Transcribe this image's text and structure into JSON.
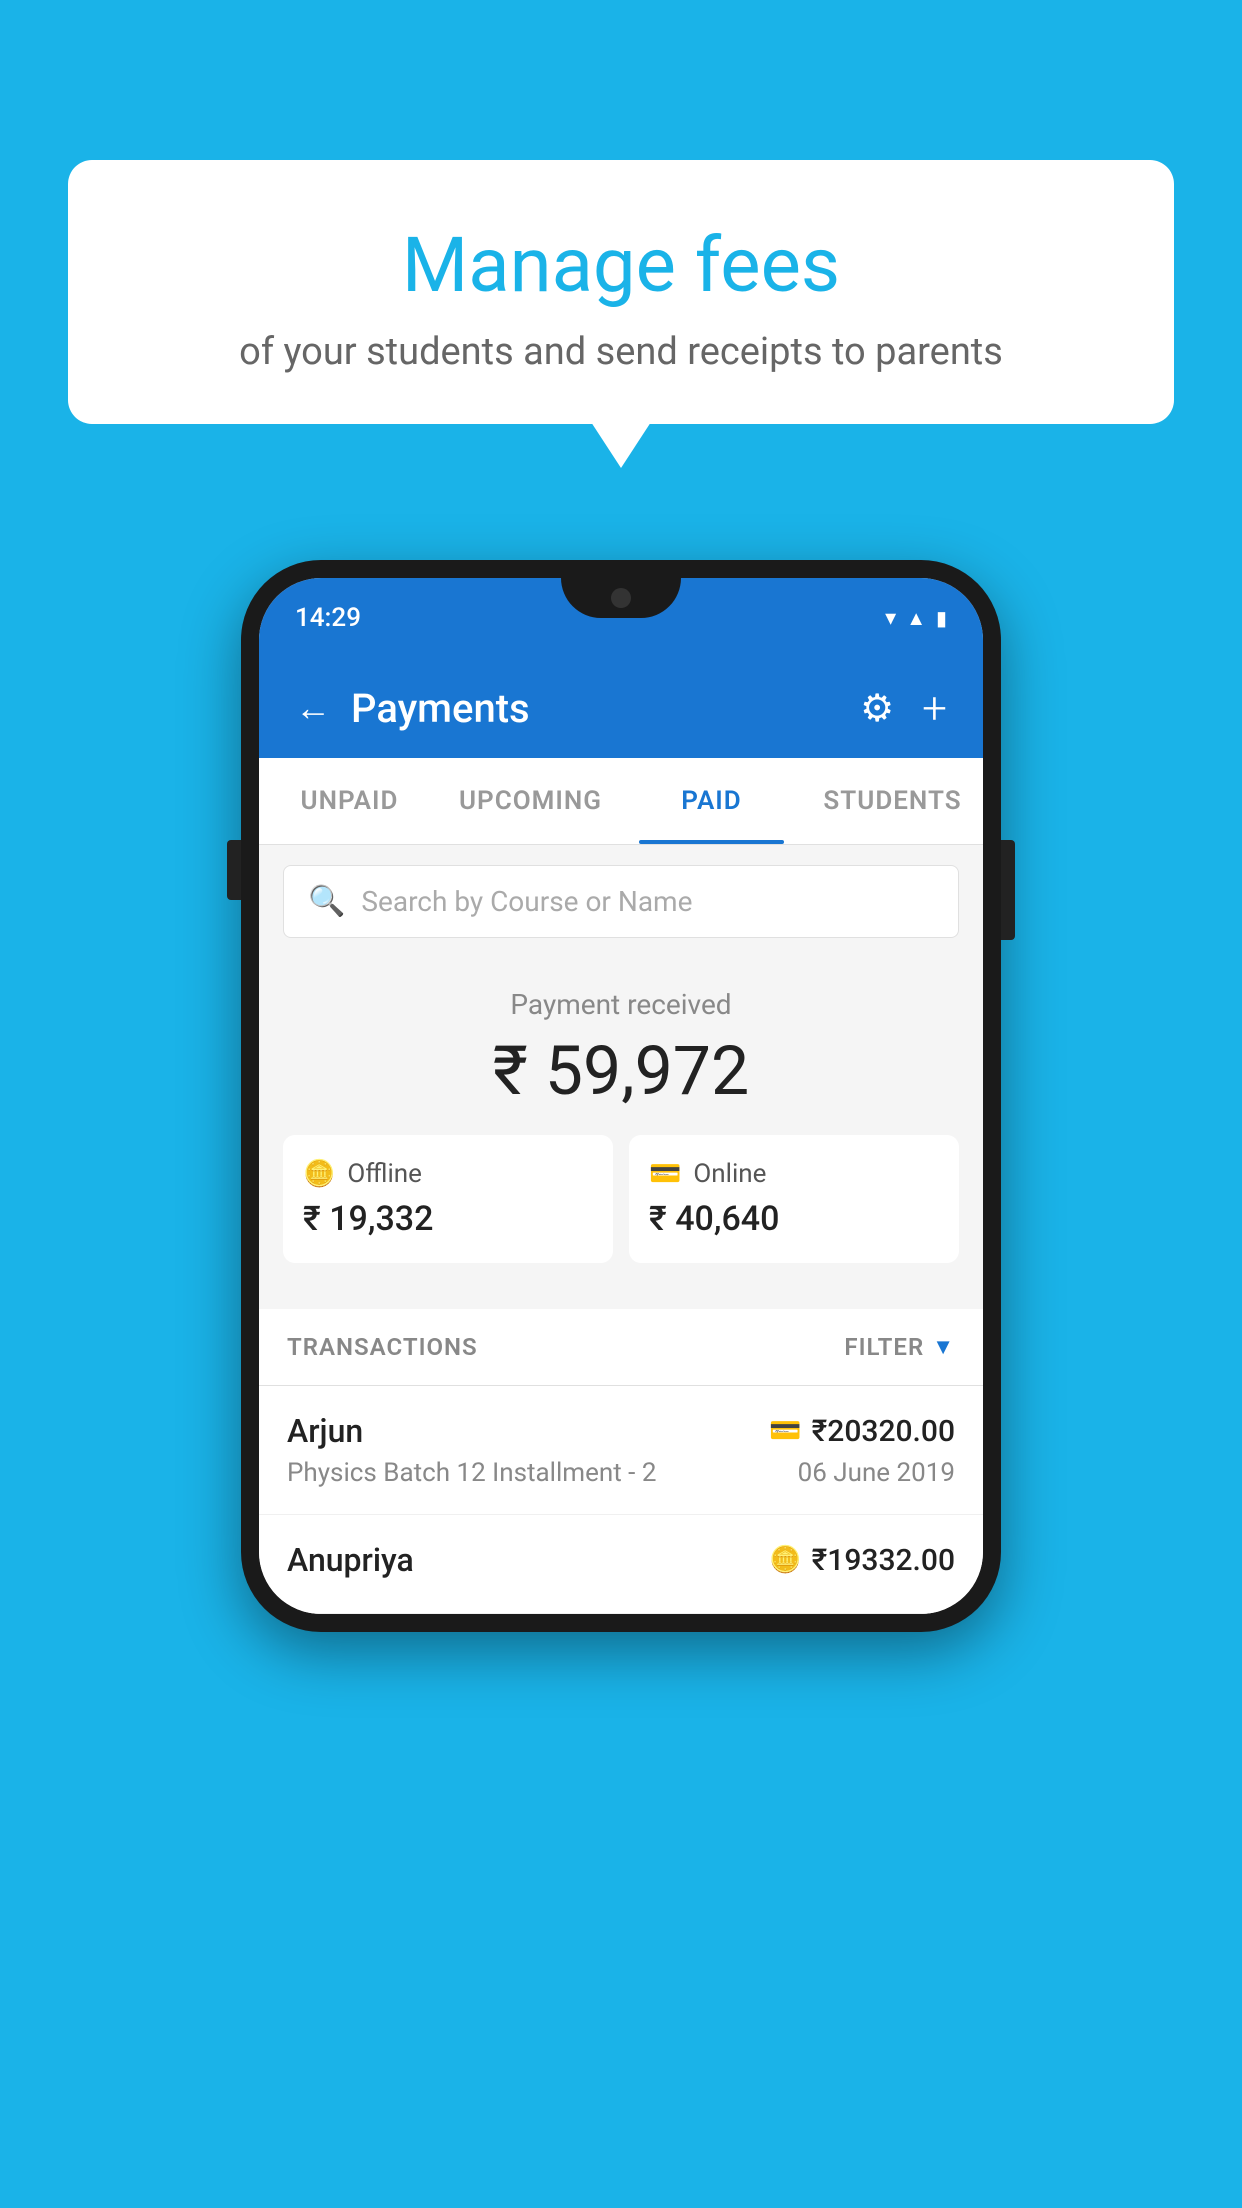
{
  "background_color": "#1ab3e8",
  "speech_bubble": {
    "title": "Manage fees",
    "subtitle": "of your students and send receipts to parents"
  },
  "phone": {
    "status_bar": {
      "time": "14:29"
    },
    "header": {
      "title": "Payments",
      "back_label": "←",
      "gear_label": "⚙",
      "plus_label": "+"
    },
    "tabs": [
      {
        "label": "UNPAID",
        "active": false
      },
      {
        "label": "UPCOMING",
        "active": false
      },
      {
        "label": "PAID",
        "active": true
      },
      {
        "label": "STUDENTS",
        "active": false
      }
    ],
    "search": {
      "placeholder": "Search by Course or Name"
    },
    "payment_summary": {
      "label": "Payment received",
      "total": "₹ 59,972",
      "offline": {
        "label": "Offline",
        "amount": "₹ 19,332"
      },
      "online": {
        "label": "Online",
        "amount": "₹ 40,640"
      }
    },
    "transactions": {
      "header_label": "TRANSACTIONS",
      "filter_label": "FILTER",
      "items": [
        {
          "name": "Arjun",
          "amount": "₹20320.00",
          "detail": "Physics Batch 12 Installment - 2",
          "date": "06 June 2019",
          "payment_type": "card"
        },
        {
          "name": "Anupriya",
          "amount": "₹19332.00",
          "detail": "",
          "date": "",
          "payment_type": "cash"
        }
      ]
    }
  }
}
